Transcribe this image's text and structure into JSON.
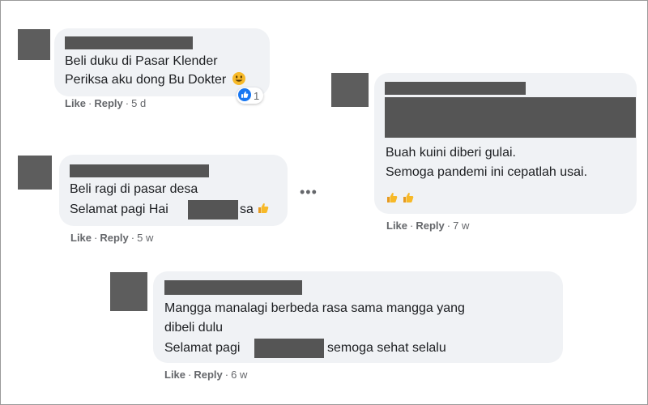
{
  "comments": [
    {
      "lines": [
        "Beli duku di Pasar Klender",
        "Periksa aku dong Bu Dokter"
      ],
      "trailing_emoji": "smiley-emoji",
      "reaction": {
        "icon": "like-reaction-icon",
        "count": "1"
      },
      "actions": {
        "like": "Like",
        "reply": "Reply",
        "time": "5 d"
      }
    },
    {
      "lines": [
        "Beli ragi di pasar desa",
        "Selamat pagi Hai",
        "sa"
      ],
      "trailing_emoji": "thumbs-up-emoji",
      "more": "•••",
      "actions": {
        "like": "Like",
        "reply": "Reply",
        "time": "5 w"
      }
    },
    {
      "lines": [
        "Buah kuini diberi gulai.",
        "Semoga pandemi ini cepatlah usai."
      ],
      "trailing_emoji": "thumbs-up-emoji x2",
      "actions": {
        "like": "Like",
        "reply": "Reply",
        "time": "7 w"
      }
    },
    {
      "lines": [
        "Mangga manalagi berbeda rasa sama mangga yang",
        "dibeli dulu",
        "Selamat pagi",
        "semoga sehat selalu"
      ],
      "actions": {
        "like": "Like",
        "reply": "Reply",
        "time": "6 w"
      }
    }
  ],
  "colors": {
    "bubble": "#f0f2f5",
    "redaction": "#555555",
    "avatar": "#5d5d5d",
    "meta_text": "#65676b",
    "like_blue": "#1877f2",
    "emoji_yellow": "#f7b928"
  }
}
